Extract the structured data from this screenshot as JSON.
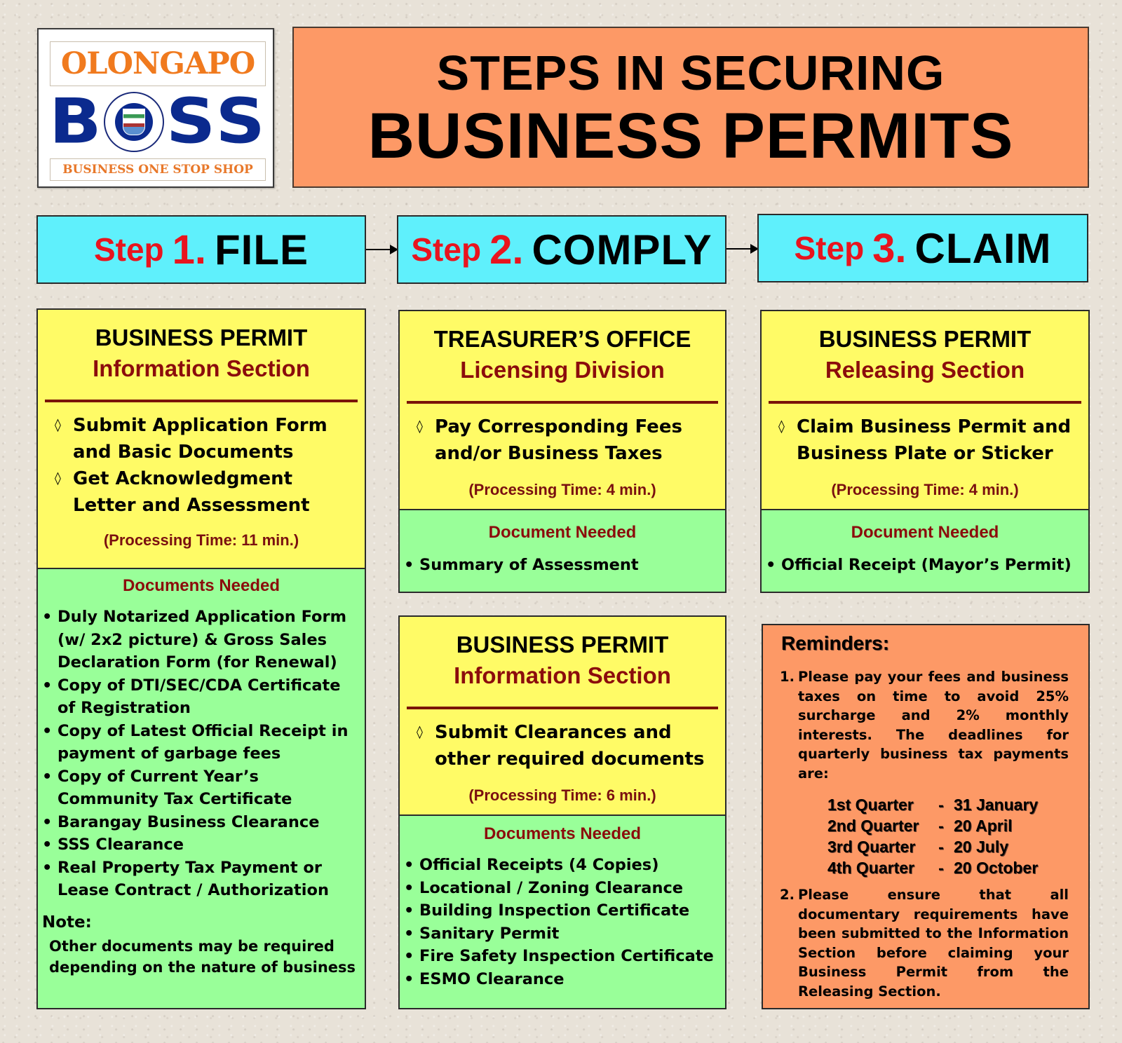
{
  "logo": {
    "city": "OLONGAPO",
    "letters": [
      "B",
      "S",
      "S"
    ],
    "seal_icon": "city-seal-icon",
    "tagline": "BUSINESS ONE STOP SHOP"
  },
  "title": {
    "line1": "STEPS IN SECURING",
    "line2": "BUSINESS PERMITS"
  },
  "steps": [
    {
      "word": "Step",
      "number": "1.",
      "name": "FILE"
    },
    {
      "word": "Step",
      "number": "2.",
      "name": "COMPLY"
    },
    {
      "word": "Step",
      "number": "3.",
      "name": "CLAIM"
    }
  ],
  "colors": {
    "title_bg": "#fd9966",
    "step_bg": "#5ff0fc",
    "step_red": "#e8141e",
    "panel_yellow": "#fffb66",
    "panel_green": "#99ff99",
    "heading_maroon": "#8b0c0c"
  },
  "panels": {
    "file": {
      "heading1": "BUSINESS PERMIT",
      "heading2": "Information Section",
      "actions": [
        "Submit Application Form and Basic Documents",
        "Get Acknowledgment Letter and Assessment"
      ],
      "processing_time": "(Processing Time: 11 min.)",
      "docs_title": "Documents Needed",
      "docs": [
        "Duly Notarized Application Form (w/ 2x2 picture) & Gross Sales Declaration Form (for Renewal)",
        "Copy of DTI/SEC/CDA Certificate of Registration",
        "Copy of Latest Official Receipt in payment of garbage fees",
        "Copy of Current Year’s Community Tax Certificate",
        "Barangay Business Clearance",
        "SSS Clearance",
        "Real Property Tax Payment or Lease Contract  / Authorization"
      ],
      "note_title": "Note:",
      "note_text": "Other documents may be required depending on the nature of business"
    },
    "comply_treasurer": {
      "heading1": "TREASURER’S OFFICE",
      "heading2": "Licensing Division",
      "actions": [
        "Pay Corresponding Fees and/or Business Taxes"
      ],
      "processing_time": "(Processing Time: 4 min.)",
      "docs_title": "Document Needed",
      "docs": [
        "Summary of Assessment"
      ]
    },
    "comply_info": {
      "heading1": "BUSINESS PERMIT",
      "heading2": "Information Section",
      "actions": [
        "Submit Clearances and other required documents"
      ],
      "processing_time": "(Processing Time: 6 min.)",
      "docs_title": "Documents Needed",
      "docs": [
        "Official Receipts (4 Copies)",
        "Locational / Zoning Clearance",
        "Building Inspection Certificate",
        "Sanitary Permit",
        "Fire Safety Inspection Certificate",
        "ESMO Clearance"
      ]
    },
    "claim": {
      "heading1": "BUSINESS PERMIT",
      "heading2": "Releasing Section",
      "actions": [
        "Claim Business Permit and Business Plate or Sticker"
      ],
      "processing_time": "(Processing Time: 4 min.)",
      "docs_title": "Document Needed",
      "docs": [
        "Official Receipt (Mayor’s Permit)"
      ]
    }
  },
  "reminders": {
    "title": "Reminders:",
    "items": [
      {
        "num": "1.",
        "text": "Please pay your fees and business taxes on time to avoid 25% surcharge and 2% monthly interests. The deadlines for quarterly business tax payments are:"
      },
      {
        "num": "2.",
        "text": "Please ensure that all documentary requirements have been submitted to the Information Section before claiming your Business Permit from the Releasing Section."
      }
    ],
    "quarters": [
      {
        "name": "1st Quarter",
        "sep": "-",
        "date": "31 January"
      },
      {
        "name": "2nd Quarter",
        "sep": "-",
        "date": "20 April"
      },
      {
        "name": "3rd Quarter",
        "sep": "-",
        "date": "20 July"
      },
      {
        "name": "4th Quarter",
        "sep": "-",
        "date": "20 October"
      }
    ]
  },
  "icons": {
    "action_bullet": "◊",
    "arrow": "right-arrow-icon"
  }
}
